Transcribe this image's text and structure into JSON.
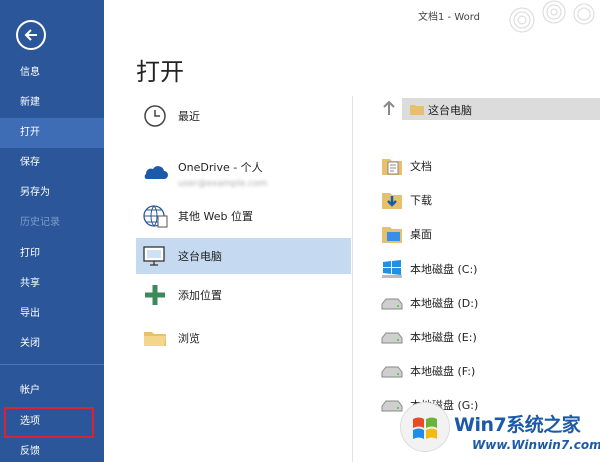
{
  "window": {
    "title": "文档1 - Word"
  },
  "sidebar": {
    "items": [
      {
        "label": "信息",
        "state": "normal"
      },
      {
        "label": "新建",
        "state": "normal"
      },
      {
        "label": "打开",
        "state": "active"
      },
      {
        "label": "保存",
        "state": "normal"
      },
      {
        "label": "另存为",
        "state": "normal"
      },
      {
        "label": "历史记录",
        "state": "disabled"
      },
      {
        "label": "打印",
        "state": "normal"
      },
      {
        "label": "共享",
        "state": "normal"
      },
      {
        "label": "导出",
        "state": "normal"
      },
      {
        "label": "关闭",
        "state": "normal"
      },
      {
        "label": "帐户",
        "state": "normal"
      },
      {
        "label": "选项",
        "state": "highlighted"
      },
      {
        "label": "反馈",
        "state": "normal"
      }
    ]
  },
  "page": {
    "title": "打开"
  },
  "locations": [
    {
      "label": "最近",
      "icon": "clock-icon"
    },
    {
      "label": "OneDrive - 个人",
      "sub": "user@example.com",
      "icon": "cloud-icon"
    },
    {
      "label": "其他 Web 位置",
      "icon": "globe-icon"
    },
    {
      "label": "这台电脑",
      "icon": "computer-icon",
      "selected": true
    },
    {
      "label": "添加位置",
      "icon": "plus-icon"
    },
    {
      "label": "浏览",
      "icon": "folder-icon"
    }
  ],
  "path": {
    "current": "这台电脑"
  },
  "folders": [
    {
      "label": "文档",
      "icon": "documents-folder-icon"
    },
    {
      "label": "下载",
      "icon": "downloads-folder-icon"
    },
    {
      "label": "桌面",
      "icon": "desktop-folder-icon"
    },
    {
      "label": "本地磁盘 (C:)",
      "icon": "windows-drive-icon"
    },
    {
      "label": "本地磁盘 (D:)",
      "icon": "drive-icon"
    },
    {
      "label": "本地磁盘 (E:)",
      "icon": "drive-icon"
    },
    {
      "label": "本地磁盘 (F:)",
      "icon": "drive-icon"
    },
    {
      "label": "本地磁盘 (G:)",
      "icon": "drive-icon"
    }
  ],
  "watermark": {
    "title": "Win7系统之家",
    "url": "Www.Winwin7.com"
  },
  "colors": {
    "sidebar": "#2b579a",
    "sidebar_active": "#3e6db5",
    "selected": "#c5daf1",
    "highlight_box": "#d9232e"
  }
}
